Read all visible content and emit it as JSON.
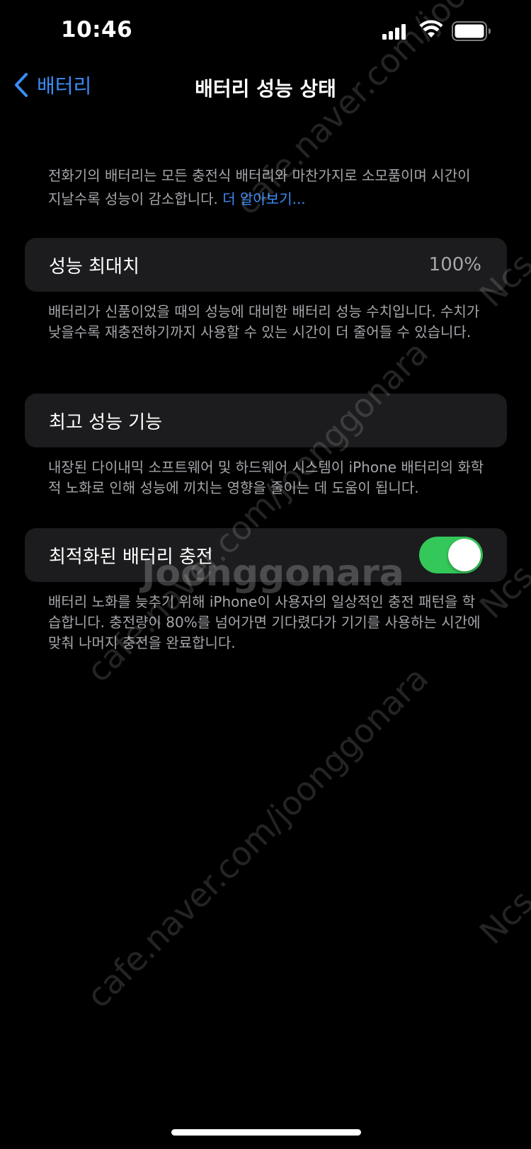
{
  "status_bar": {
    "time": "10:46"
  },
  "nav": {
    "back_label": "배터리",
    "title": "배터리 성능 상태"
  },
  "intro": {
    "text": "전화기의 배터리는 모든 충전식 배터리와 마찬가지로 소모품이며 시간이 지날수록 성능이 감소합니다. ",
    "link": "더 알아보기..."
  },
  "maximum_capacity": {
    "label": "성능 최대치",
    "value": "100%",
    "footer": "배터리가 신품이었을 때의 성능에 대비한 배터리 성능 수치입니다. 수치가 낮을수록 재충전하기까지 사용할 수 있는 시간이 더 줄어들 수 있습니다."
  },
  "peak_performance": {
    "label": "최고 성능 기능",
    "footer": "내장된 다이내믹 소프트웨어 및 하드웨어 시스템이 iPhone 배터리의 화학적 노화로 인해 성능에 끼치는 영향을 줄이는 데 도움이 됩니다."
  },
  "optimized_charging": {
    "label": "최적화된 배터리 충전",
    "enabled": true,
    "footer": "배터리 노화를 늦추기 위해 iPhone이 사용자의 일상적인 충전 패턴을 학습합니다. 충전량이 80%를 넘어가면 기다렸다가 기기를 사용하는 시간에 맞춰 나머지 충전을 완료합니다."
  },
  "watermark": {
    "site": "cafe.naver.com/joonggonara",
    "brand": "Joonggonara",
    "tag": "Ncs"
  },
  "colors": {
    "accent": "#3b8cf6",
    "toggle_on": "#34c759",
    "cell_bg": "#1c1c1e",
    "secondary_text": "#a6a6ab"
  }
}
